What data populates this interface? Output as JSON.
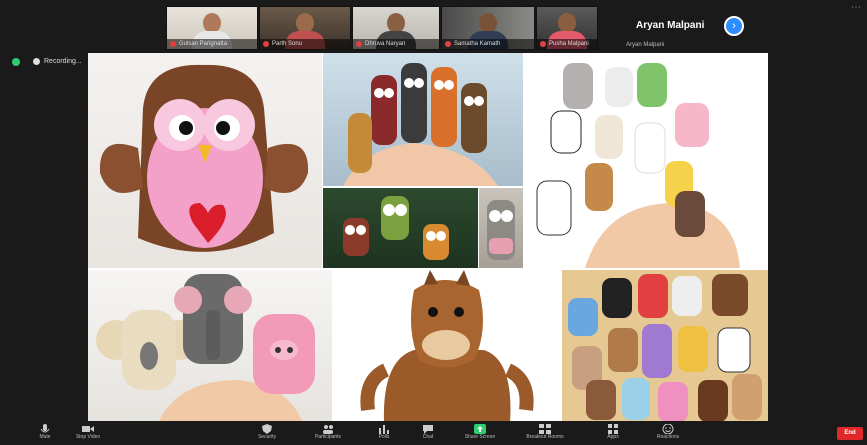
{
  "participants": [
    {
      "name": "Gulsan Parignatta"
    },
    {
      "name": "Parth Sonu"
    },
    {
      "name": "Dhruva Naryan"
    },
    {
      "name": "Samatha Kamath"
    },
    {
      "name": "Pusha Malpani"
    }
  ],
  "active_speaker": {
    "name": "Aryan Malpani",
    "caption": "Aryan Malpani"
  },
  "recording": {
    "label": "Recording...",
    "controls": "▮▮ ■"
  },
  "toolbar": {
    "items": [
      {
        "label": "Mute",
        "icon": "mic-icon"
      },
      {
        "label": "Stop Video",
        "icon": "camera-icon"
      },
      {
        "label": "Security",
        "icon": "shield-icon"
      },
      {
        "label": "Participants",
        "icon": "participants-icon"
      },
      {
        "label": "Polls",
        "icon": "polls-icon"
      },
      {
        "label": "Chat",
        "icon": "chat-icon"
      },
      {
        "label": "Share Screen",
        "icon": "share-icon"
      },
      {
        "label": "Breakout Rooms",
        "icon": "breakout-icon"
      },
      {
        "label": "Apps",
        "icon": "apps-icon"
      },
      {
        "label": "Reactions",
        "icon": "reactions-icon"
      }
    ],
    "end_label": "End"
  },
  "colors": {
    "accent": "#2d8cff",
    "end": "#e02828",
    "status": "#2ecc71"
  }
}
